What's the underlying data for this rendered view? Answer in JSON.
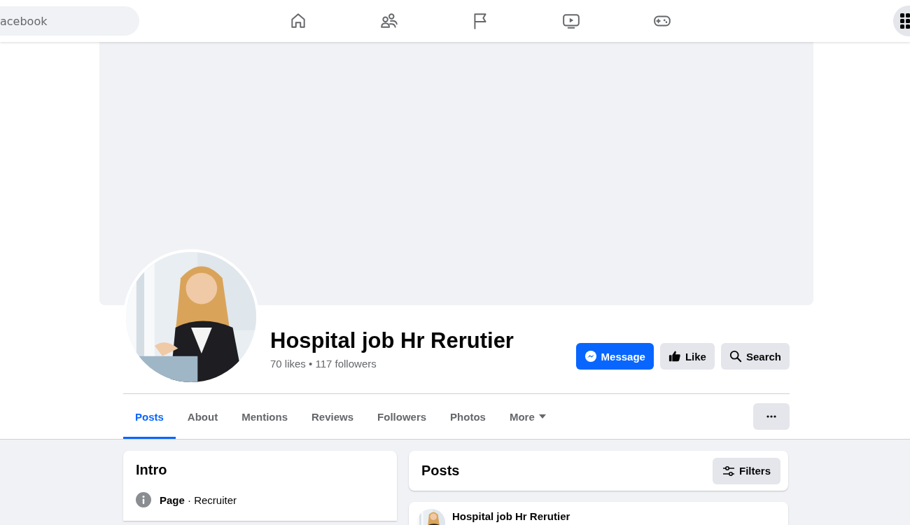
{
  "top_bar": {
    "search": {
      "placeholder": "acebook"
    },
    "nav": [
      {
        "kind": "home",
        "selected": false
      },
      {
        "kind": "friends",
        "selected": false
      },
      {
        "kind": "flag",
        "selected": false
      },
      {
        "kind": "video",
        "selected": false
      },
      {
        "kind": "gaming",
        "selected": false
      }
    ]
  },
  "profile": {
    "name": "Hospital job Hr Rerutier",
    "stats": "70 likes • 117 followers",
    "actions": [
      {
        "kind": "messenger",
        "label": "Message",
        "primary": true
      },
      {
        "kind": "like",
        "label": "Like",
        "primary": false
      },
      {
        "kind": "search",
        "label": "Search",
        "primary": false
      }
    ]
  },
  "tabs": [
    {
      "label": "Posts",
      "selected": true
    },
    {
      "label": "About",
      "selected": false
    },
    {
      "label": "Mentions",
      "selected": false
    },
    {
      "label": "Reviews",
      "selected": false
    },
    {
      "label": "Followers",
      "selected": false
    },
    {
      "label": "Photos",
      "selected": false
    },
    {
      "label": "More",
      "selected": false,
      "dropdown": true
    }
  ],
  "intro": {
    "title": "Intro",
    "items": [
      {
        "kind": "info",
        "text": "**Page** · Recruiter"
      }
    ]
  },
  "posts": {
    "title": "Posts",
    "filter_button": "Filters",
    "items": [
      {
        "author": "Hospital job Hr Rerutier"
      }
    ]
  }
}
